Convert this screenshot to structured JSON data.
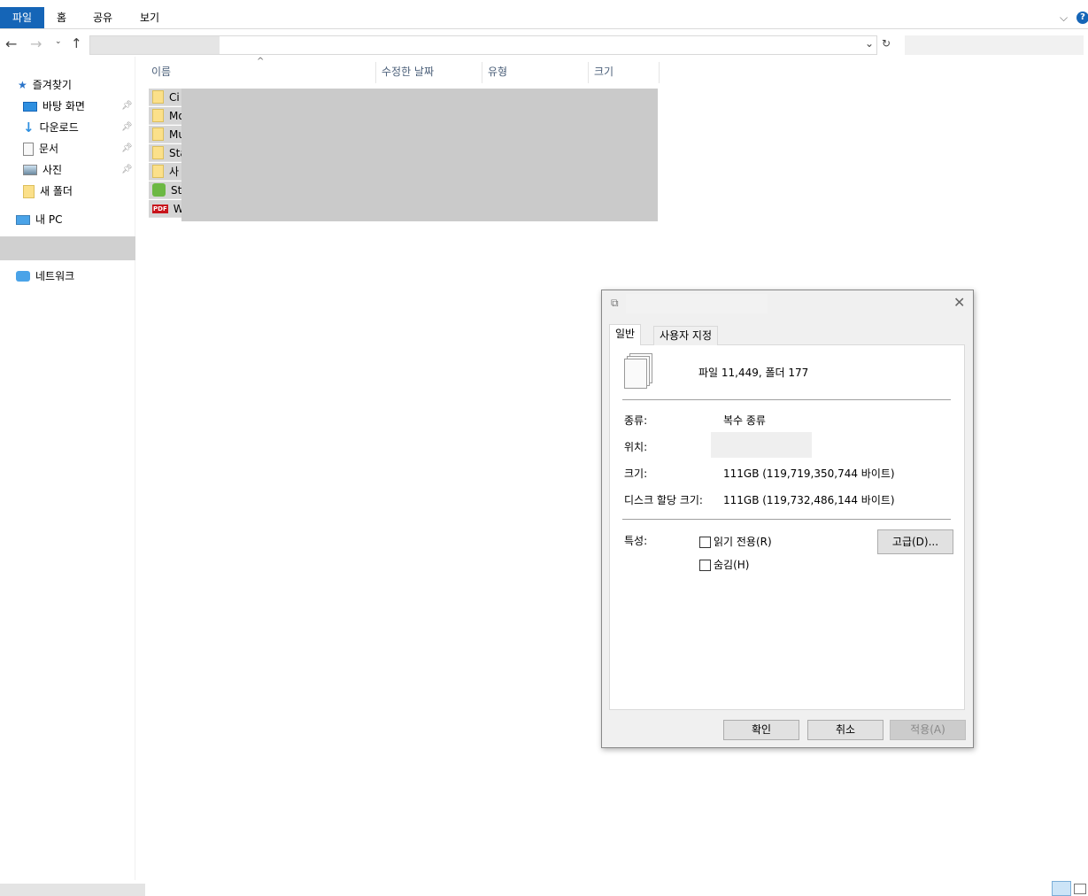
{
  "ribbon": {
    "tabs": [
      "파일",
      "홈",
      "공유",
      "보기"
    ]
  },
  "sidebar": {
    "quick_access": "즐겨찾기",
    "items": [
      {
        "label": "바탕 화면",
        "icon": "desktop-icon"
      },
      {
        "label": "다운로드",
        "icon": "download-icon"
      },
      {
        "label": "문서",
        "icon": "document-icon"
      },
      {
        "label": "사진",
        "icon": "pictures-icon"
      },
      {
        "label": "새 폴더",
        "icon": "folder-icon"
      }
    ],
    "this_pc": "내 PC",
    "network": "네트워크"
  },
  "columns": [
    "이름",
    "수정한 날짜",
    "유형",
    "크기"
  ],
  "files": [
    {
      "name": "Ci",
      "icon": "folder"
    },
    {
      "name": "Mo",
      "icon": "folder"
    },
    {
      "name": "Mu",
      "icon": "folder"
    },
    {
      "name": "Sta",
      "icon": "folder"
    },
    {
      "name": "사",
      "icon": "folder"
    },
    {
      "name": "Sta",
      "icon": "app"
    },
    {
      "name": "Wa",
      "icon": "pdf"
    }
  ],
  "dialog": {
    "tabs": [
      "일반",
      "사용자 지정"
    ],
    "summary": "파일 11,449, 폴더 177",
    "type_label": "종류:",
    "type_value": "복수 종류",
    "location_label": "위치:",
    "size_label": "크기:",
    "size_value": "111GB (119,719,350,744 바이트)",
    "disk_label": "디스크 할당 크기:",
    "disk_value": "111GB (119,732,486,144 바이트)",
    "attr_label": "특성:",
    "readonly": "읽기 전용(R)",
    "hidden": "숨김(H)",
    "advanced": "고급(D)...",
    "ok": "확인",
    "cancel": "취소",
    "apply": "적용(A)"
  }
}
